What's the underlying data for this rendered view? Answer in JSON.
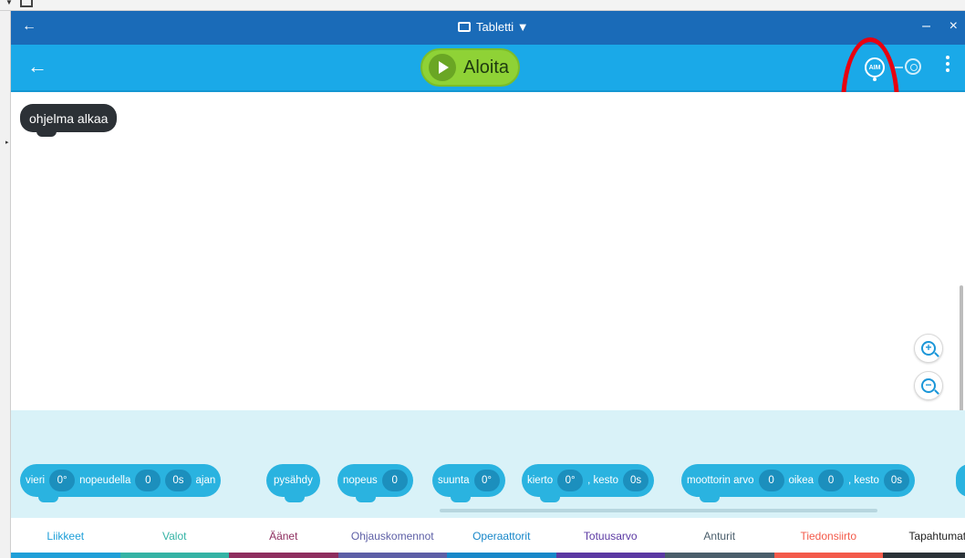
{
  "window": {
    "device_label": "Tabletti ▼",
    "back_glyph": "←",
    "min_glyph": "–",
    "close_glyph": "×"
  },
  "background": {
    "caret": "▼"
  },
  "appbar": {
    "back_glyph": "←",
    "run_label": "Aloita",
    "aim_label": "AIM"
  },
  "canvas": {
    "start_block": "ohjelma alkaa",
    "zoom_in": "+",
    "zoom_out": "−"
  },
  "palette": {
    "blocks": [
      {
        "parts": [
          "vieri",
          "0°",
          "nopeudella",
          "0",
          "0s",
          "ajan"
        ]
      },
      {
        "parts": [
          "pysähdy"
        ]
      },
      {
        "parts": [
          "nopeus",
          "0"
        ]
      },
      {
        "parts": [
          "suunta",
          "0°"
        ]
      },
      {
        "parts": [
          "kierto",
          "0°",
          ", kesto",
          "0s"
        ]
      },
      {
        "parts": [
          "moottorin arvo",
          "0",
          "oikea",
          "0",
          ", kesto",
          "0s"
        ]
      }
    ]
  },
  "tabs": [
    {
      "label": "Liikkeet",
      "color": "#1e9fd8"
    },
    {
      "label": "Valot",
      "color": "#34b3a5"
    },
    {
      "label": "Äänet",
      "color": "#8e2e5f"
    },
    {
      "label": "Ohjauskomennot",
      "color": "#5d5fa6"
    },
    {
      "label": "Operaattorit",
      "color": "#1787c9"
    },
    {
      "label": "Totuusarvo",
      "color": "#5b39a3"
    },
    {
      "label": "Anturit",
      "color": "#4a5e6b"
    },
    {
      "label": "Tiedonsiirto",
      "color": "#f35a4a"
    },
    {
      "label": "Tapahtumat",
      "color": "#2b3238"
    }
  ],
  "colors": {
    "titlebar": "#1a6bb8",
    "appbar": "#1aa9e8",
    "run_button": "#8fd236",
    "block": "#2ab3e0",
    "palette_bg": "#d9f2f8",
    "annotation_ring": "#e8000f"
  }
}
